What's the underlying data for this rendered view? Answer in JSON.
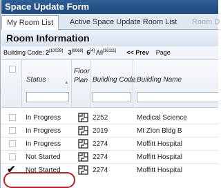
{
  "form": {
    "title": "Space Update Form"
  },
  "tabs": [
    {
      "label": "My Room List",
      "active": true
    },
    {
      "label": "Active Space Update Room List"
    },
    {
      "label": "Room D",
      "disabled": true
    }
  ],
  "section": {
    "title": "Room Information"
  },
  "toolbar": {
    "building_code_label": "Building Code:",
    "codes": [
      {
        "code": "2",
        "count": "[10039]"
      },
      {
        "code": "3",
        "count": "[6068]"
      },
      {
        "code": "6",
        "count": "[4]"
      },
      {
        "code": "All",
        "count": "[16111]"
      }
    ],
    "prev_label": "<< Prev",
    "page_label": "Page"
  },
  "columns": {
    "status": "Status",
    "floor_plan": "Floor Plan",
    "building_code": "Building Code",
    "building_name": "Building Name"
  },
  "rows": [
    {
      "status": "In Progress",
      "code": "2252",
      "name": "Medical Science",
      "checked": false
    },
    {
      "status": "In Progress",
      "code": "2019",
      "name": "Mt Zion Bldg B",
      "checked": false
    },
    {
      "status": "In Progress",
      "code": "2274",
      "name": "Moffitt Hospital",
      "checked": false
    },
    {
      "status": "Not Started",
      "code": "2274",
      "name": "Moffitt Hospital",
      "checked": false
    },
    {
      "status": "Not Started",
      "code": "2274",
      "name": "Moffitt Hospital",
      "checked": true
    }
  ],
  "colors": {
    "title_bar": "#2f5f95",
    "highlight": "#b5202a"
  },
  "icons": {
    "floor_plan": "floor-plan-icon",
    "check": "checkmark-icon"
  }
}
